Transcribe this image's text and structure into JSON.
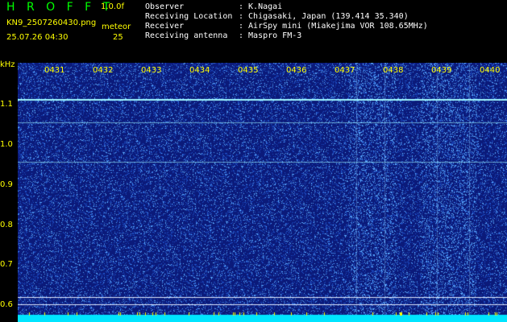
{
  "header": {
    "logo": "H R O F F T",
    "version": "1.0.0f",
    "filename": "KN9_2507260430.png",
    "datetime": "25.07.26 04:30",
    "event_label": "meteor",
    "event_count": "25",
    "info": [
      {
        "key": "Observer",
        "value": ": K.Nagai"
      },
      {
        "key": "Receiving Location",
        "value": ": Chigasaki, Japan (139.414 35.340)"
      },
      {
        "key": "Receiver",
        "value": ": AirSpy mini (Miakejima VOR 108.65MHz)"
      },
      {
        "key": "Receiving antenna",
        "value": ": Maspro FM-3"
      }
    ]
  },
  "y_axis": {
    "unit": "kHz",
    "ticks": [
      "1.1",
      "1.0",
      "0.9",
      "0.8",
      "0.7",
      "0.6"
    ]
  },
  "x_axis": {
    "ticks": [
      "0431",
      "0432",
      "0433",
      "0434",
      "0435",
      "0436",
      "0437",
      "0438",
      "0439",
      "0440"
    ]
  },
  "colors": {
    "background": "#0b1a7a",
    "noise_bright": "#5ab0ff",
    "signal": "#9ff7ff",
    "baseline": "#00e5ff",
    "labels": "#ffff00",
    "logo": "#00ff00"
  }
}
